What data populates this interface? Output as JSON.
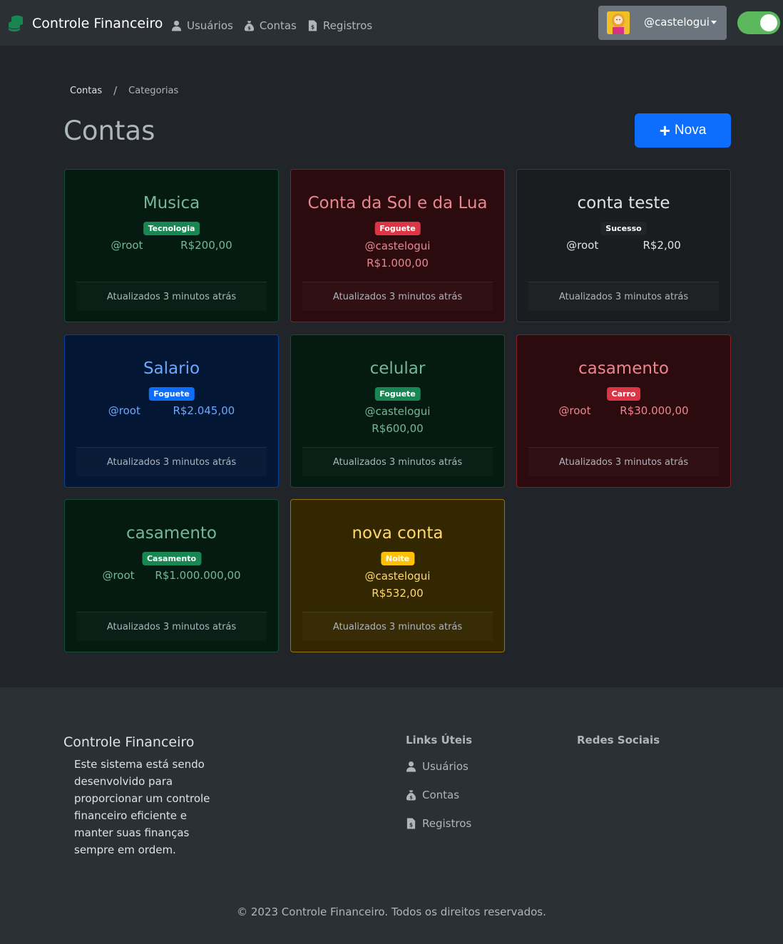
{
  "navbar": {
    "brand": "Controle Financeiro",
    "links": [
      {
        "label": "Usuários",
        "icon": "user-icon"
      },
      {
        "label": "Contas",
        "icon": "money-bag-icon"
      },
      {
        "label": "Registros",
        "icon": "file-invoice-icon"
      }
    ],
    "user": "@castelogui",
    "theme_toggle_on": true
  },
  "breadcrumb": {
    "items": [
      "Contas",
      "Categorias"
    ],
    "separator": "/"
  },
  "page": {
    "title": "Contas",
    "new_button": "Nova",
    "new_button_icon": "+"
  },
  "cards": [
    {
      "title": "Musica",
      "badge": "Tecnologia",
      "user": "@root",
      "amount": "R$200,00",
      "updated": "Atualizados 3 minutos atrás",
      "color": "#75b798"
    },
    {
      "title": "Conta da Sol e da Lua",
      "badge": "Foguete",
      "user": "@castelogui",
      "amount": "R$1.000,00",
      "updated": "Atualizados 3 minutos atrás",
      "color": "#ea868f"
    },
    {
      "title": "conta teste",
      "badge": "Sucesso",
      "user": "@root",
      "amount": "R$2,00",
      "updated": "Atualizados 3 minutos atrás",
      "color": "#dee2e6"
    },
    {
      "title": "Salario",
      "badge": "Foguete",
      "user": "@root",
      "amount": "R$2.045,00",
      "updated": "Atualizados 3 minutos atrás",
      "color": "#6ea8fe"
    },
    {
      "title": "celular",
      "badge": "Foguete",
      "user": "@castelogui",
      "amount": "R$600,00",
      "updated": "Atualizados 3 minutos atrás",
      "color": "#75b798"
    },
    {
      "title": "casamento",
      "badge": "Carro",
      "user": "@root",
      "amount": "R$30.000,00",
      "updated": "Atualizados 3 minutos atrás",
      "color": "#ea868f"
    },
    {
      "title": "casamento",
      "badge": "Casamento",
      "user": "@root",
      "amount": "R$1.000.000,00",
      "updated": "Atualizados 3 minutos atrás",
      "color": "#75b798"
    },
    {
      "title": "nova conta",
      "badge": "Noite",
      "user": "@castelogui",
      "amount": "R$532,00",
      "updated": "Atualizados 3 minutos atrás",
      "color": "#ffda6a"
    }
  ],
  "footer": {
    "title": "Controle Financeiro",
    "description": "Este sistema está sendo desenvolvido para proporcionar um controle financeiro eficiente e manter suas finanças sempre em ordem.",
    "links_title": "Links Úteis",
    "links": [
      {
        "label": "Usuários",
        "icon": "user-icon"
      },
      {
        "label": "Contas",
        "icon": "money-bag-icon"
      },
      {
        "label": "Registros",
        "icon": "file-invoice-icon"
      }
    ],
    "social_title": "Redes Sociais",
    "copyright": "© 2023 Controle Financeiro. Todos os direitos reservados."
  }
}
